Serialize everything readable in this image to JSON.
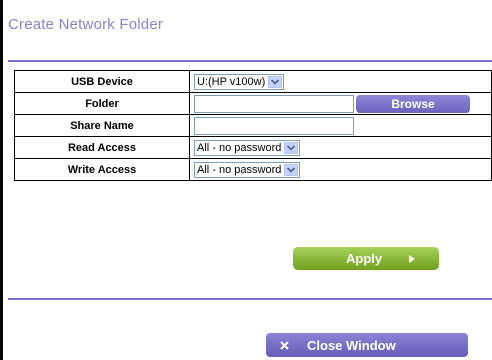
{
  "page": {
    "title": "Create Network Folder"
  },
  "form": {
    "usb_device": {
      "label": "USB Device",
      "value": "U:(HP v100w)"
    },
    "folder": {
      "label": "Folder",
      "value": "",
      "browse_label": "Browse"
    },
    "share_name": {
      "label": "Share Name",
      "value": ""
    },
    "read_access": {
      "label": "Read Access",
      "value": "All - no password"
    },
    "write_access": {
      "label": "Write Access",
      "value": "All - no password"
    }
  },
  "actions": {
    "apply_label": "Apply",
    "close_label": "Close Window"
  },
  "colors": {
    "title": "#8a84cc",
    "divider": "#7b74c8",
    "purple_button": "#7a71c9",
    "apply_button": "#8bbb34"
  },
  "icons": {
    "dropdown": "chevron-down-icon",
    "apply": "arrow-right-icon",
    "close": "close-icon"
  }
}
